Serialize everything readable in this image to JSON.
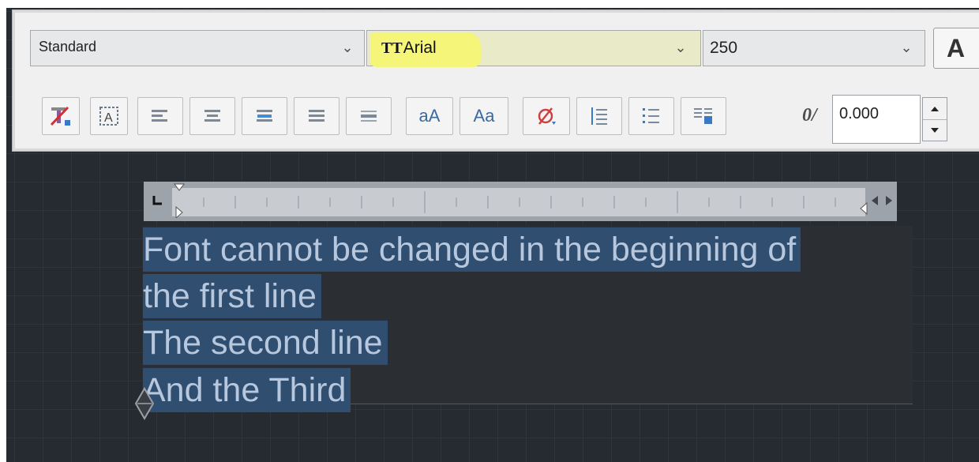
{
  "toolbar": {
    "text_style": "Standard",
    "font_name": "Arial",
    "font_icon": "truetype-icon",
    "text_height": "250",
    "bold_label": "A",
    "format_buttons": [
      {
        "name": "clear-formatting-icon"
      },
      {
        "name": "text-frame-icon"
      },
      {
        "name": "align-left-icon"
      },
      {
        "name": "align-center-icon"
      },
      {
        "name": "align-right-icon"
      },
      {
        "name": "justify-icon"
      },
      {
        "name": "distribute-icon"
      },
      {
        "name": "lowercase-button",
        "label": "aA"
      },
      {
        "name": "titlecase-button",
        "label": "Aa"
      },
      {
        "name": "symbol-icon"
      },
      {
        "name": "line-spacing-icon"
      },
      {
        "name": "numbering-icon"
      },
      {
        "name": "columns-icon"
      }
    ],
    "oblique_symbol": "0/",
    "oblique_value": "0.000"
  },
  "editor": {
    "lines": [
      "Font cannot be changed in the beginning of",
      "the first line",
      "The second line",
      "And the Third"
    ],
    "text_color": "#b7c7dd",
    "selection_color": "#2f4e70"
  },
  "highlight_color": "#f5f57a"
}
